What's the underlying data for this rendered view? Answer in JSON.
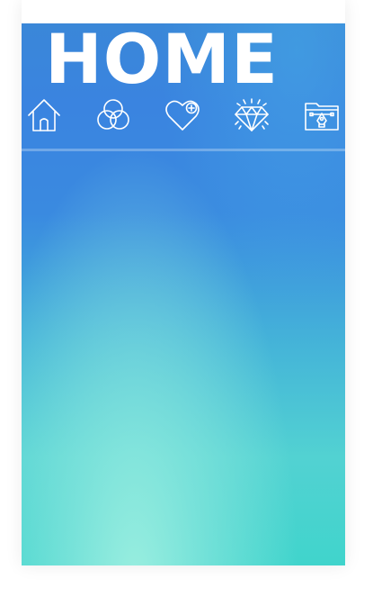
{
  "page": {
    "title": "HOME"
  },
  "nav": {
    "items": [
      {
        "name": "home",
        "icon": "home-icon"
      },
      {
        "name": "circles",
        "icon": "venn-circles-icon"
      },
      {
        "name": "favorites",
        "icon": "heart-plus-icon"
      },
      {
        "name": "premium",
        "icon": "diamond-icon"
      },
      {
        "name": "design",
        "icon": "folder-pen-tool-icon"
      }
    ]
  },
  "colors": {
    "gradient_top": "#3a87d8",
    "gradient_bottom": "#40d4cc",
    "glow": "#a0f0e1",
    "icon_stroke": "#ffffff"
  }
}
